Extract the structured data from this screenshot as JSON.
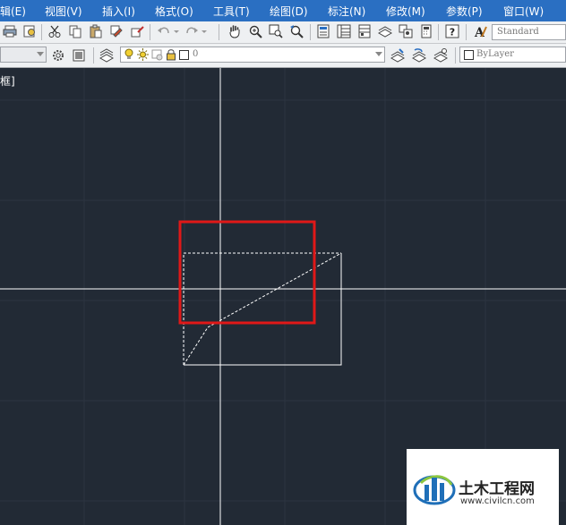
{
  "menu": {
    "items": [
      "辑(E)",
      "视图(V)",
      "插入(I)",
      "格式(O)",
      "工具(T)",
      "绘图(D)",
      "标注(N)",
      "修改(M)",
      "参数(P)",
      "窗口(W)"
    ]
  },
  "toolbar": {
    "text_style": "Standard",
    "layer_value": "0",
    "linetype_value": "ByLayer"
  },
  "viewport": {
    "label": "框]"
  },
  "watermark": {
    "name": "土木工程网",
    "url": "www.civilcn.com"
  },
  "colors": {
    "menubar": "#2a6fc2",
    "canvas": "#222a35",
    "highlight": "#e01818",
    "crosshair": "#ffffff"
  }
}
